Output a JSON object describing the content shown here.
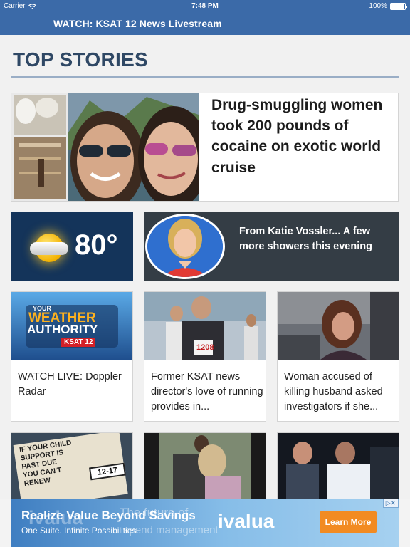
{
  "status_bar": {
    "carrier": "Carrier",
    "time": "7:48 PM",
    "battery": "100%"
  },
  "nav": {
    "title": "WATCH: KSAT 12 News Livestream"
  },
  "section": {
    "title": "TOP STORIES"
  },
  "hero": {
    "headline": "Drug-smuggling women took 200 pounds of cocaine on exotic world cruise"
  },
  "weather": {
    "temperature": "80°"
  },
  "katie": {
    "text": "From Katie Vossler... A few more showers this evening"
  },
  "tiles": [
    {
      "caption": "WATCH LIVE: Doppler Radar",
      "logo_line1": "YOUR",
      "logo_line2": "WEATHER",
      "logo_line3": "AUTHORITY",
      "logo_badge": "KSAT 12"
    },
    {
      "caption": "Former KSAT news director's love of running provides in...",
      "bib": "1208"
    },
    {
      "caption": "Woman accused of killing husband asked investigators if she..."
    }
  ],
  "bottom_row": {
    "sign_lines": [
      "IF YOUR CHILD",
      "SUPPORT IS",
      "PAST DUE",
      "YOU CAN'T",
      "RENEW"
    ],
    "sign_date": "12-17"
  },
  "ad": {
    "headline": "Realize Value Beyond Savings",
    "subline": "One Suite. Infinite Possibilities.",
    "ghost_word": "ivalua",
    "ghost_line1": "The future of",
    "ghost_line2": "spend management",
    "logo": "ivalua",
    "cta": "Learn More",
    "choices": "▷✕"
  },
  "colors": {
    "nav": "#3b6aa8",
    "section_title": "#2f4865",
    "weather_bg": "#14345a",
    "katie_bg": "#343d45",
    "cta": "#f28b22"
  }
}
